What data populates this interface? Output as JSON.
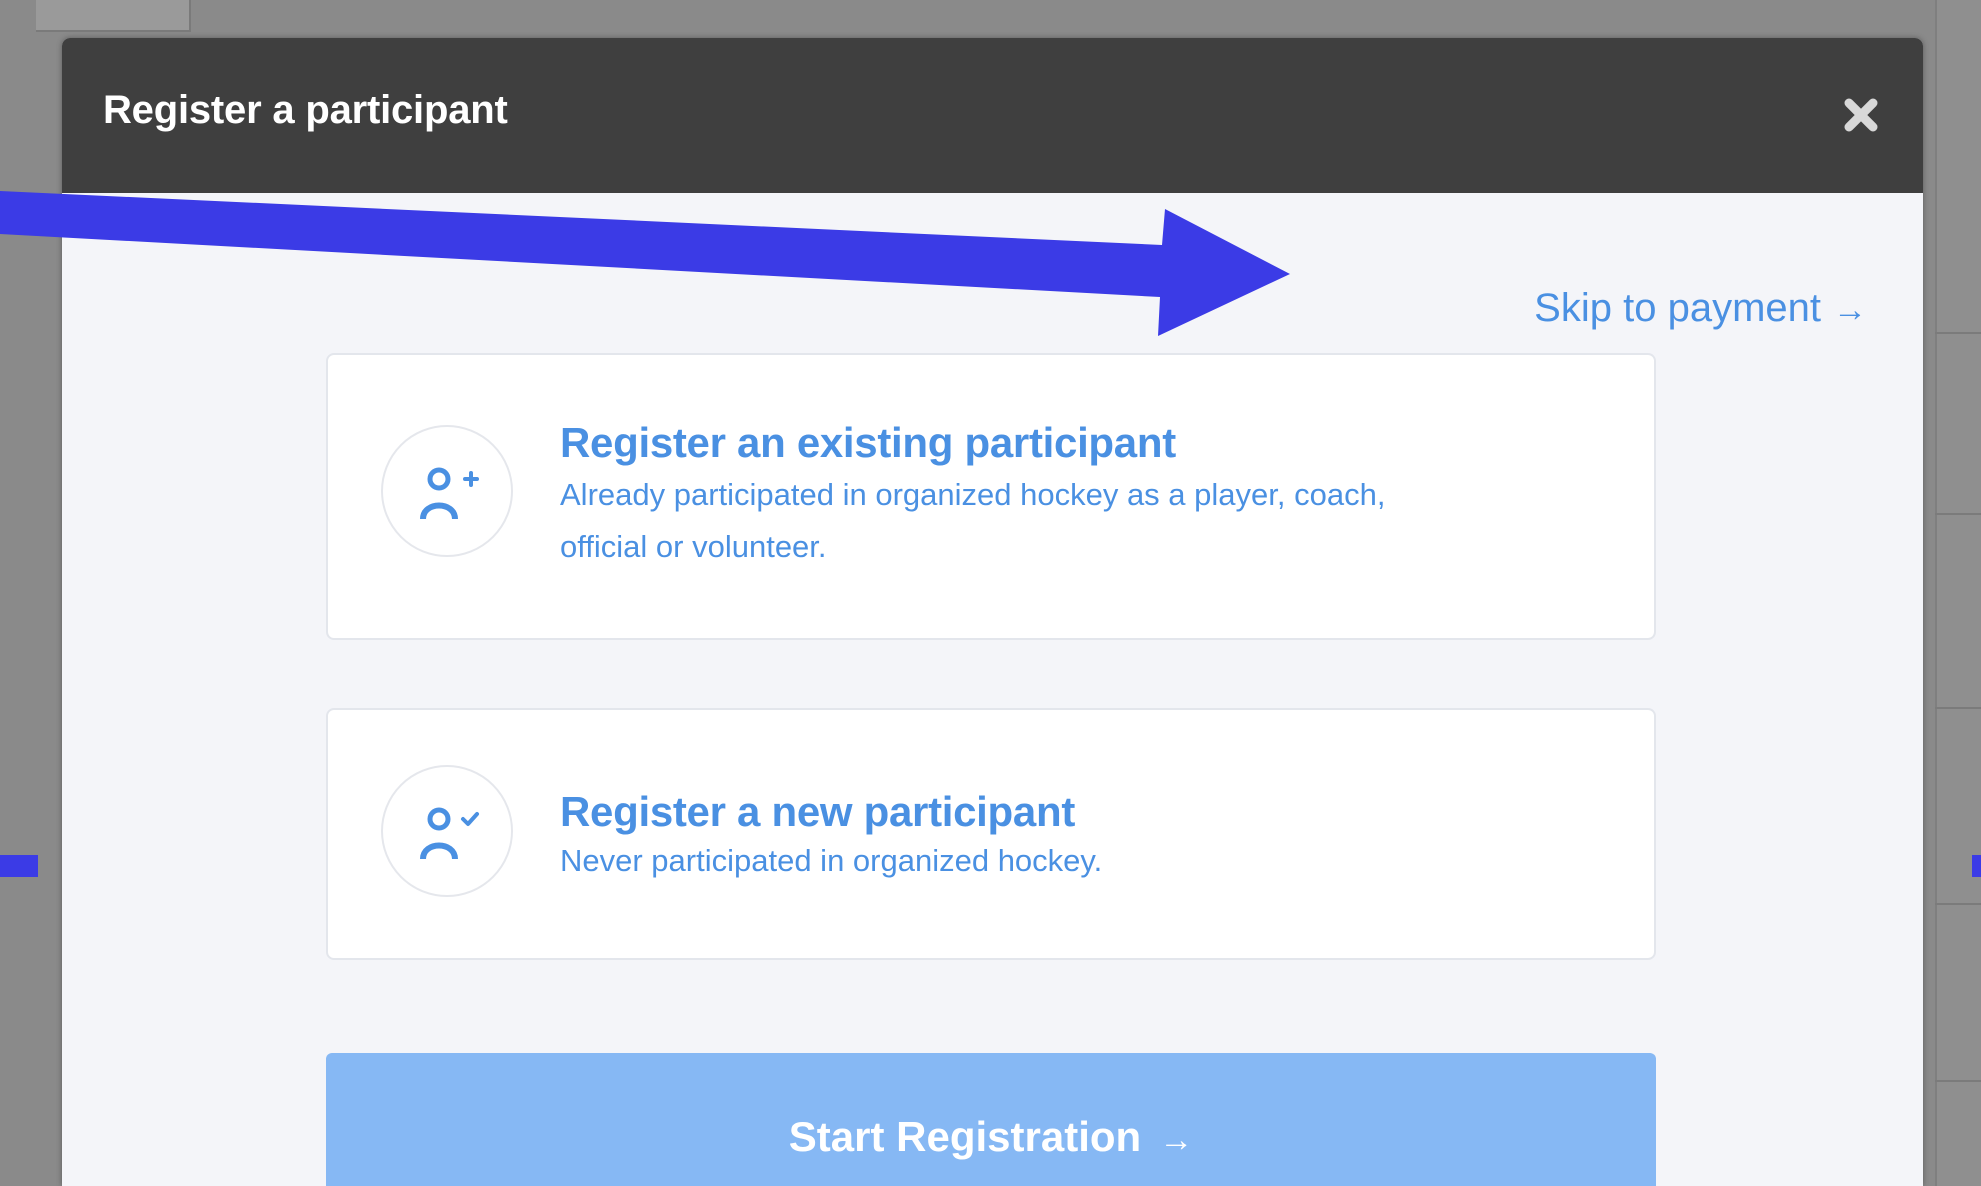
{
  "modal": {
    "title": "Register a participant",
    "close_icon": "close-icon"
  },
  "skip_link": {
    "label": "Skip to payment",
    "arrow": "→"
  },
  "options": [
    {
      "title": "Register an existing participant",
      "description": "Already participated in organized hockey as a player, coach, official or volunteer.",
      "icon": "user-plus-icon"
    },
    {
      "title": "Register a new participant",
      "description": "Never participated in organized hockey.",
      "icon": "user-check-icon"
    }
  ],
  "start_button": {
    "label": "Start Registration",
    "arrow": "→"
  },
  "colors": {
    "accent": "#4a90e2",
    "header": "#3f3f3f",
    "button_disabled": "#86b8f4",
    "annotation_arrow": "#3b3be6"
  }
}
